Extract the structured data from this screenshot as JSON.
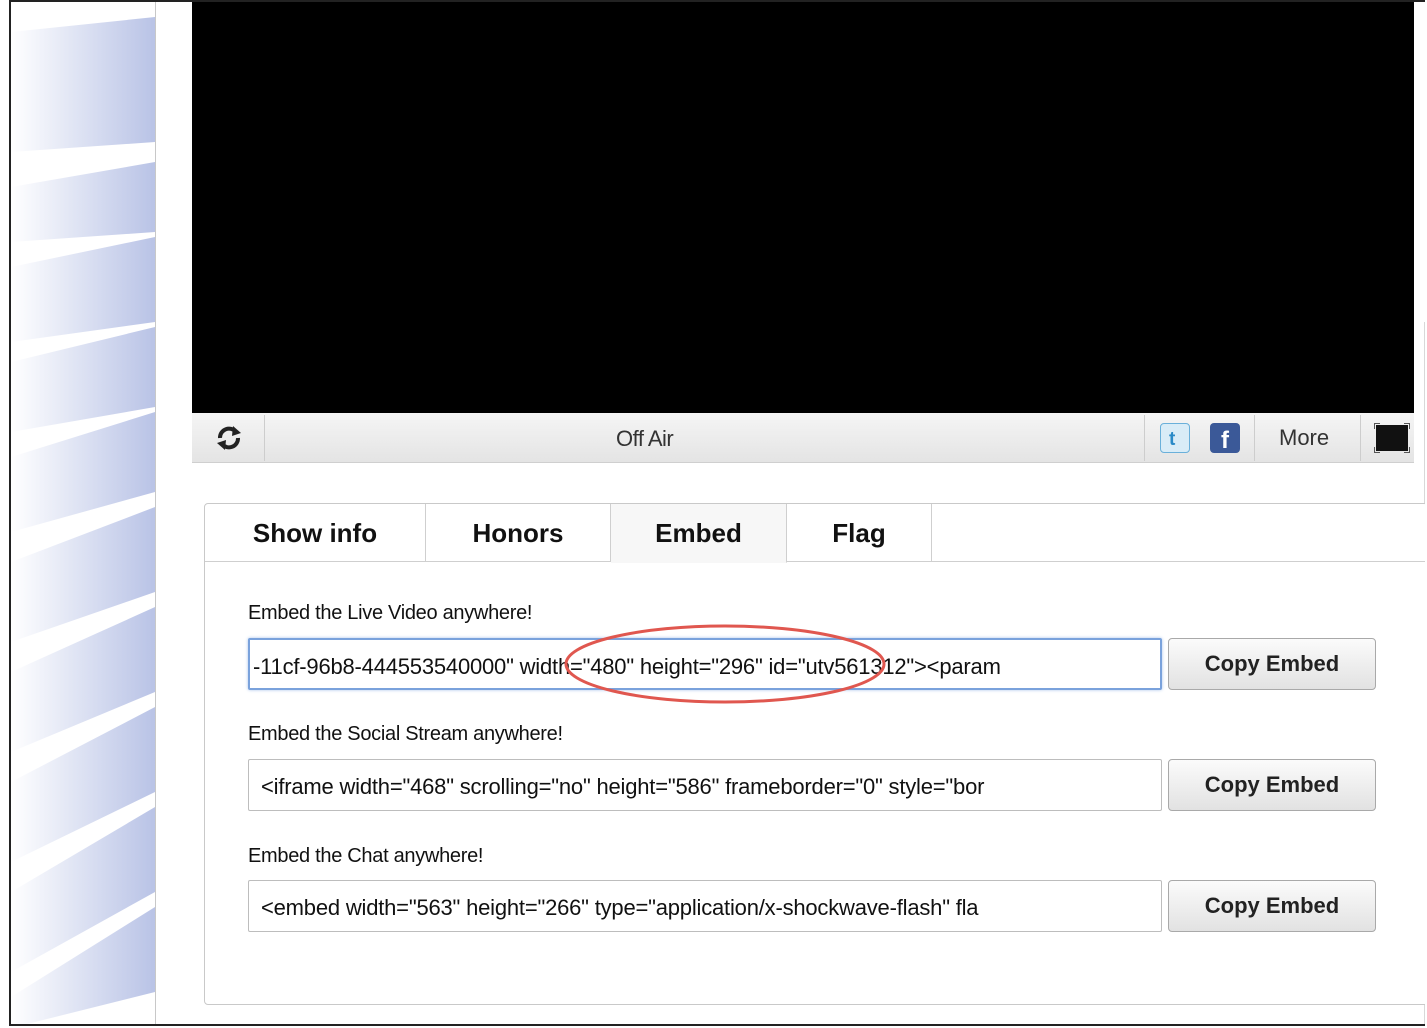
{
  "player": {
    "status": "Off Air",
    "more_label": "More"
  },
  "tabs": [
    {
      "label": "Show info",
      "active": false
    },
    {
      "label": "Honors",
      "active": false
    },
    {
      "label": "Embed",
      "active": true
    },
    {
      "label": "Flag",
      "active": false
    }
  ],
  "embeds": [
    {
      "label": "Embed the Live Video anywhere!",
      "code": "-11cf-96b8-444553540000\" width=\"480\" height=\"296\" id=\"utv561312\"><param",
      "button": "Copy Embed"
    },
    {
      "label": "Embed the Social Stream anywhere!",
      "code": "<iframe width=\"468\" scrolling=\"no\" height=\"586\" frameborder=\"0\" style=\"bor",
      "button": "Copy Embed"
    },
    {
      "label": "Embed the Chat anywhere!",
      "code": "<embed width=\"563\" height=\"266\" type=\"application/x-shockwave-flash\" fla",
      "button": "Copy Embed"
    }
  ],
  "colors": {
    "twitter_icon": "#6ab0da",
    "facebook_icon": "#3b5998",
    "highlight_ellipse": "#e0574f",
    "focus_ring": "#7aa2dc"
  }
}
